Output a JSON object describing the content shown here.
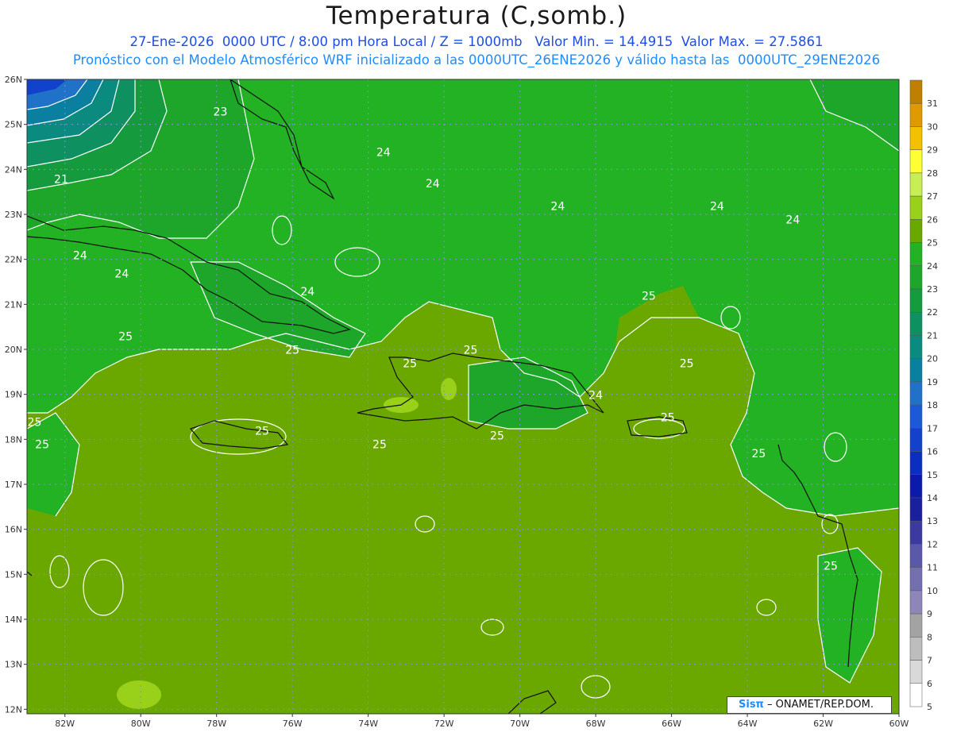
{
  "header": {
    "title": "Temperatura (C,somb.)",
    "line1": "27-Ene-2026  0000 UTC / 8:00 pm Hora Local / Z = 1000mb   Valor Min. = 14.4915  Valor Max. = 27.5861",
    "line2": "Pronóstico con el Modelo Atmosférico WRF inicializado a las 0000UTC_26ENE2026 y válido hasta las  0000UTC_29ENE2026"
  },
  "axes": {
    "lat_labels": [
      "26N",
      "25N",
      "24N",
      "23N",
      "22N",
      "21N",
      "20N",
      "19N",
      "18N",
      "17N",
      "16N",
      "15N",
      "14N",
      "13N",
      "12N"
    ],
    "lon_labels": [
      "82W",
      "80W",
      "78W",
      "76W",
      "74W",
      "72W",
      "70W",
      "68W",
      "66W",
      "64W",
      "62W",
      "60W"
    ]
  },
  "colorbar": {
    "labels": [
      "31",
      "30",
      "29",
      "28",
      "27",
      "26",
      "25",
      "24",
      "23",
      "22",
      "21",
      "20",
      "19",
      "18",
      "17",
      "16",
      "15",
      "14",
      "13",
      "12",
      "11",
      "10",
      "9",
      "8",
      "7",
      "6",
      "5"
    ],
    "colors": [
      "#c07f00",
      "#e09a00",
      "#f5c000",
      "#ffff33",
      "#c8ee55",
      "#99d01a",
      "#6aa800",
      "#23b223",
      "#1ea62a",
      "#159a3e",
      "#0e9060",
      "#0b8a80",
      "#0a7fa0",
      "#1f72c8",
      "#1a5ad6",
      "#1242cc",
      "#0a2fc0",
      "#0b19ad",
      "#1a1f9c",
      "#3b3a9e",
      "#5a58a8",
      "#7470b0",
      "#8e85b8",
      "#a3a3a3",
      "#bdbdbd",
      "#d9d9d9",
      "#ffffff"
    ]
  },
  "contour_labels": [
    {
      "text": "23",
      "lon": -77.9,
      "lat": 25.2
    },
    {
      "text": "24",
      "lon": -73.6,
      "lat": 24.3
    },
    {
      "text": "24",
      "lon": -72.3,
      "lat": 23.6
    },
    {
      "text": "24",
      "lon": -69.0,
      "lat": 23.1
    },
    {
      "text": "24",
      "lon": -64.8,
      "lat": 23.1
    },
    {
      "text": "24",
      "lon": -62.8,
      "lat": 22.8
    },
    {
      "text": "24",
      "lon": -81.6,
      "lat": 22.0
    },
    {
      "text": "24",
      "lon": -80.5,
      "lat": 21.6
    },
    {
      "text": "24",
      "lon": -75.6,
      "lat": 21.2
    },
    {
      "text": "21",
      "lon": -82.1,
      "lat": 23.7
    },
    {
      "text": "25",
      "lon": -80.4,
      "lat": 20.2
    },
    {
      "text": "25",
      "lon": -76.0,
      "lat": 19.9
    },
    {
      "text": "25",
      "lon": -72.9,
      "lat": 19.6
    },
    {
      "text": "25",
      "lon": -71.3,
      "lat": 19.9
    },
    {
      "text": "25",
      "lon": -66.6,
      "lat": 21.1
    },
    {
      "text": "25",
      "lon": -65.6,
      "lat": 19.6
    },
    {
      "text": "24",
      "lon": -68.0,
      "lat": 18.9
    },
    {
      "text": "25",
      "lon": -66.1,
      "lat": 18.4
    },
    {
      "text": "25",
      "lon": -76.8,
      "lat": 18.1
    },
    {
      "text": "25",
      "lon": -73.7,
      "lat": 17.8
    },
    {
      "text": "25",
      "lon": -70.6,
      "lat": 18.0
    },
    {
      "text": "25",
      "lon": -82.8,
      "lat": 18.3
    },
    {
      "text": "25",
      "lon": -82.6,
      "lat": 17.8
    },
    {
      "text": "25",
      "lon": -63.7,
      "lat": 17.6
    },
    {
      "text": "25",
      "lon": -61.8,
      "lat": 15.1
    }
  ],
  "credit": {
    "brand": "Sisπ",
    "text": " – ONAMET/REP.DOM."
  }
}
